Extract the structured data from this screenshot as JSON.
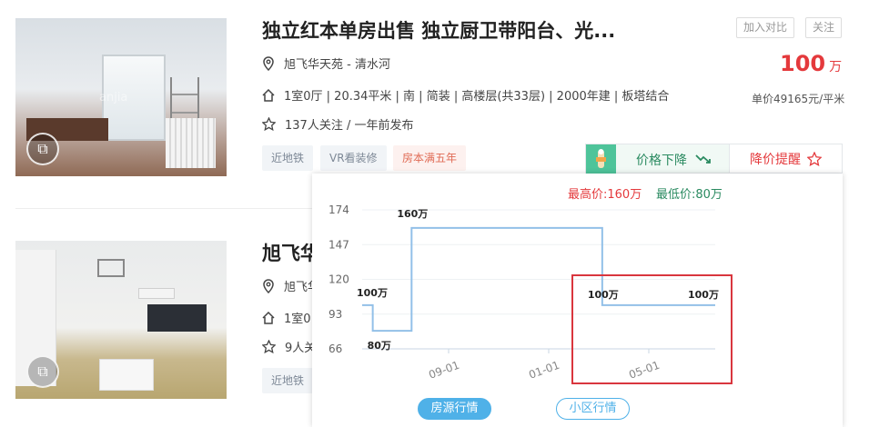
{
  "listing1": {
    "title": "独立红本单房出售 独立厨卫带阳台、光...",
    "location": "旭飞华天苑 - 清水河",
    "info": "1室0厅 | 20.34平米 | 南 | 简装 | 高楼层(共33层) | 2000年建 | 板塔结合",
    "follow": "137人关注 / 一年前发布",
    "tags": [
      "近地铁",
      "VR看装修",
      "房本满五年"
    ],
    "compare_label": "加入对比",
    "follow_label": "关注",
    "price": "100",
    "price_unit": "万",
    "unit_price": "单价49165元/平米",
    "trend_label": "价格下降",
    "alert_label": "降价提醒",
    "watermark": "anjia"
  },
  "listing2": {
    "title_partial": "旭飞华",
    "location_partial": "旭飞华",
    "info_partial": "1室0",
    "follow_partial": "9人关",
    "tag_partial": "近地铁"
  },
  "popup": {
    "max_label": "最高价:160万",
    "min_label": "最低价:80万",
    "tab_active": "房源行情",
    "tab_inactive": "小区行情"
  },
  "colors": {
    "accent_red": "#e4393c",
    "accent_green": "#2a8a60",
    "tab_blue": "#4fb1e8",
    "line_blue": "#92c0e8"
  },
  "chart_data": {
    "type": "line",
    "title": "",
    "xlabel": "",
    "ylabel": "",
    "x_ticks": [
      "09-01",
      "01-01",
      "05-01"
    ],
    "y_ticks": [
      66,
      93,
      120,
      147,
      174
    ],
    "ylim": [
      66,
      174
    ],
    "series": [
      {
        "points": [
          {
            "x": 0,
            "y": 100
          },
          {
            "x": 0.03,
            "y": 100
          },
          {
            "x": 0.03,
            "y": 80
          },
          {
            "x": 0.14,
            "y": 80
          },
          {
            "x": 0.14,
            "y": 160
          },
          {
            "x": 0.68,
            "y": 160
          },
          {
            "x": 0.68,
            "y": 100
          },
          {
            "x": 1,
            "y": 100
          }
        ]
      }
    ],
    "data_labels": [
      {
        "text": "100万",
        "x": 0,
        "y": 100
      },
      {
        "text": "80万",
        "x": 0.03,
        "y": 80
      },
      {
        "text": "160万",
        "x": 0.14,
        "y": 160
      },
      {
        "text": "100万",
        "x": 0.68,
        "y": 100
      },
      {
        "text": "100万",
        "x": 1,
        "y": 100
      }
    ],
    "grid": true
  }
}
